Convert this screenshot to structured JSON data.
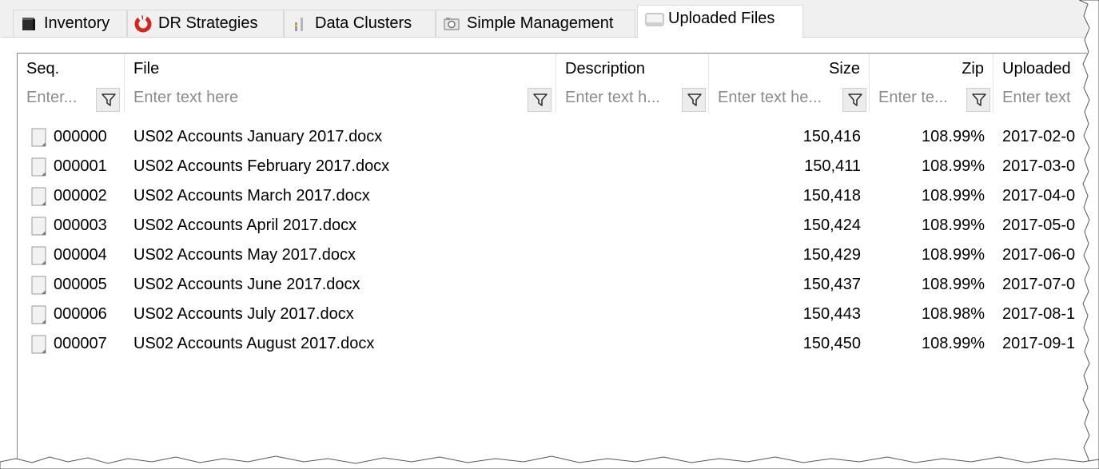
{
  "tabs": [
    {
      "label": "Inventory",
      "icon": "inventory-icon",
      "active": false
    },
    {
      "label": "DR Strategies",
      "icon": "lifebuoy-icon",
      "active": false
    },
    {
      "label": "Data Clusters",
      "icon": "data-clusters-icon",
      "active": false
    },
    {
      "label": "Simple Management",
      "icon": "simple-management-icon",
      "active": false
    },
    {
      "label": "Uploaded Files",
      "icon": "uploaded-files-icon",
      "active": true
    }
  ],
  "grid": {
    "columns": [
      {
        "label": "Seq.",
        "align": "left"
      },
      {
        "label": "File",
        "align": "left"
      },
      {
        "label": "Description",
        "align": "left"
      },
      {
        "label": "Size",
        "align": "right"
      },
      {
        "label": "Zip",
        "align": "right"
      },
      {
        "label": "Uploaded",
        "align": "left"
      }
    ],
    "filters": [
      {
        "placeholder": "Enter..."
      },
      {
        "placeholder": "Enter text here"
      },
      {
        "placeholder": "Enter text h..."
      },
      {
        "placeholder": "Enter text he..."
      },
      {
        "placeholder": "Enter te..."
      },
      {
        "placeholder": "Enter text"
      }
    ],
    "rows": [
      {
        "seq": "000000",
        "file": "US02 Accounts January 2017.docx",
        "description": "",
        "size": "150,416",
        "zip": "108.99%",
        "uploaded": "2017-02-0"
      },
      {
        "seq": "000001",
        "file": "US02 Accounts February 2017.docx",
        "description": "",
        "size": "150,411",
        "zip": "108.99%",
        "uploaded": "2017-03-0"
      },
      {
        "seq": "000002",
        "file": "US02 Accounts March 2017.docx",
        "description": "",
        "size": "150,418",
        "zip": "108.99%",
        "uploaded": "2017-04-0"
      },
      {
        "seq": "000003",
        "file": "US02 Accounts April 2017.docx",
        "description": "",
        "size": "150,424",
        "zip": "108.99%",
        "uploaded": "2017-05-0"
      },
      {
        "seq": "000004",
        "file": "US02 Accounts May 2017.docx",
        "description": "",
        "size": "150,429",
        "zip": "108.99%",
        "uploaded": "2017-06-0"
      },
      {
        "seq": "000005",
        "file": "US02 Accounts June 2017.docx",
        "description": "",
        "size": "150,437",
        "zip": "108.99%",
        "uploaded": "2017-07-0"
      },
      {
        "seq": "000006",
        "file": "US02 Accounts July 2017.docx",
        "description": "",
        "size": "150,443",
        "zip": "108.98%",
        "uploaded": "2017-08-1"
      },
      {
        "seq": "000007",
        "file": "US02 Accounts August 2017.docx",
        "description": "",
        "size": "150,450",
        "zip": "108.99%",
        "uploaded": "2017-09-1"
      }
    ]
  },
  "colors": {
    "tab_background": "#f0f0f0",
    "grid_border": "#828790",
    "placeholder_text": "#8c8c8c",
    "lifebuoy_red": "#d6251c"
  }
}
